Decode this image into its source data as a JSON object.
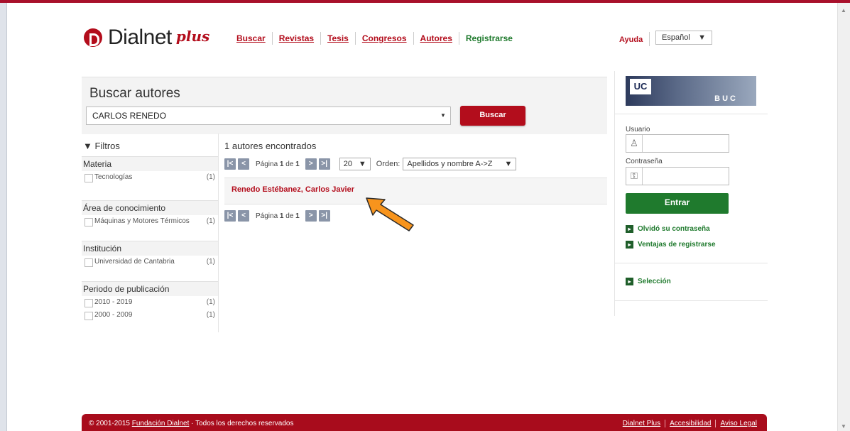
{
  "header": {
    "logo_text": "Dialnet",
    "logo_plus": "plus",
    "nav": [
      "Buscar",
      "Revistas",
      "Tesis",
      "Congresos",
      "Autores",
      "Registrarse"
    ],
    "help": "Ayuda",
    "language": "Español"
  },
  "search": {
    "title": "Buscar autores",
    "query": "CARLOS RENEDO",
    "button": "Buscar"
  },
  "filters": {
    "title": "Filtros",
    "sections": [
      {
        "title": "Materia",
        "items": [
          {
            "label": "Tecnologías",
            "count": "(1)"
          }
        ]
      },
      {
        "title": "Área de conocimiento",
        "items": [
          {
            "label": "Máquinas y Motores Térmicos",
            "count": "(1)"
          }
        ]
      },
      {
        "title": "Institución",
        "items": [
          {
            "label": "Universidad de Cantabria",
            "count": "(1)"
          }
        ]
      },
      {
        "title": "Periodo de publicación",
        "items": [
          {
            "label": "2010 - 2019",
            "count": "(1)"
          },
          {
            "label": "2000 - 2009",
            "count": "(1)"
          }
        ]
      }
    ]
  },
  "results": {
    "count_text": "1 autores encontrados",
    "page_prefix": "Página",
    "page_current": "1",
    "page_of": "de",
    "page_total": "1",
    "per_page": "20",
    "order_label": "Orden:",
    "order_value": "Apellidos y nombre A->Z",
    "items": [
      "Renedo Estébanez, Carlos Javier"
    ]
  },
  "sidebar": {
    "banner_logo": "UC",
    "banner_text": "BUC",
    "user_label": "Usuario",
    "user_value": "",
    "password_label": "Contraseña",
    "password_value": "",
    "login_button": "Entrar",
    "forgot_link": "Olvidó su contraseña",
    "benefits_link": "Ventajas de registrarse",
    "selection_link": "Selección"
  },
  "footer": {
    "copyright_prefix": "© 2001-2015",
    "foundation": "Fundación Dialnet",
    "rights": "· Todos los derechos reservados",
    "links": [
      "Dialnet Plus",
      "Accesibilidad",
      "Aviso Legal"
    ]
  },
  "colors": {
    "brand_red": "#b30d1c",
    "brand_green": "#1f7a2d",
    "annotation_arrow": "#f7941d"
  }
}
